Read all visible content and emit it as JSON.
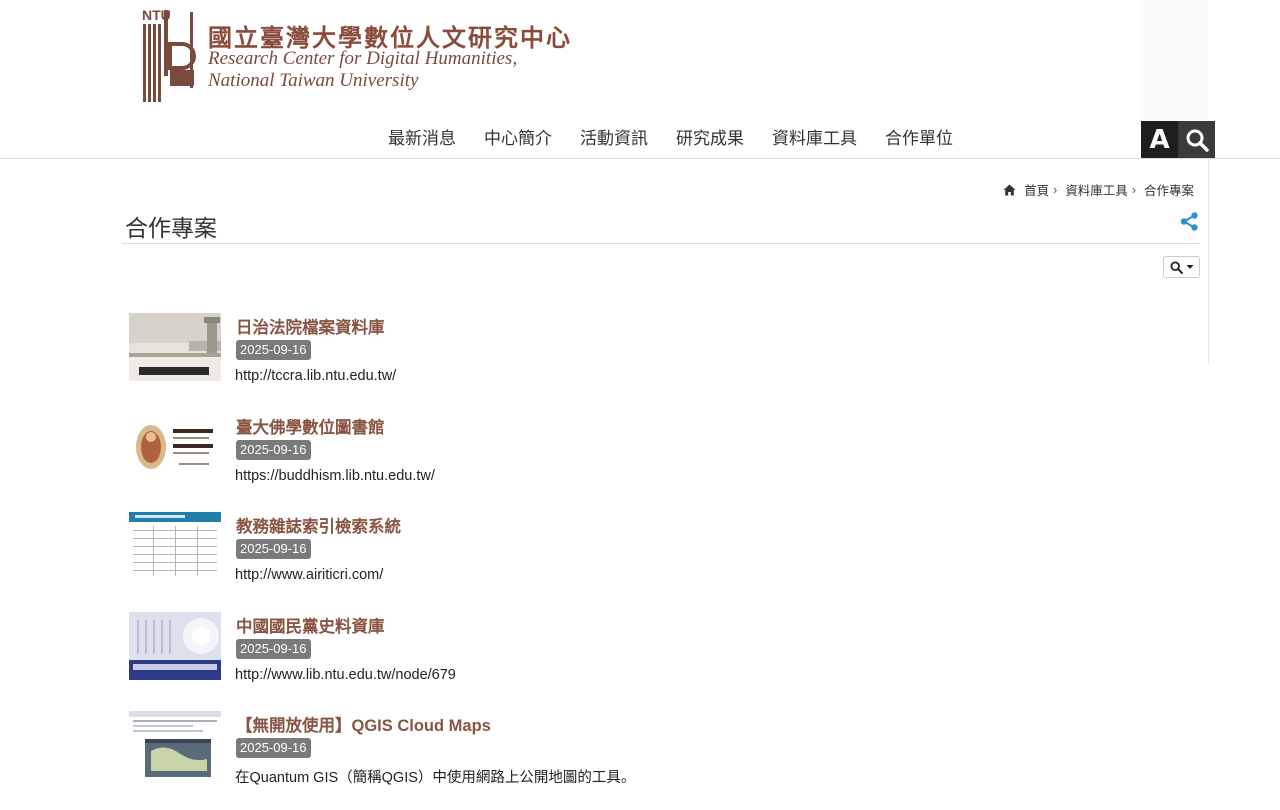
{
  "header": {
    "logo_ntu": "NTU",
    "logo_title": "國立臺灣大學數位人文研究中心",
    "logo_en_line1": "Research Center for Digital Humanities,",
    "logo_en_line2": "National Taiwan University"
  },
  "tools": {
    "font_label": "A"
  },
  "nav": {
    "items": [
      "最新消息",
      "中心簡介",
      "活動資訊",
      "研究成果",
      "資料庫工具",
      "合作單位"
    ]
  },
  "breadcrumb": {
    "items": [
      "首頁",
      "資料庫工具",
      "合作專案"
    ],
    "separator": "›"
  },
  "page": {
    "title": "合作專案"
  },
  "list": {
    "items": [
      {
        "title": "日治法院檔案資料庫",
        "date": "2025-09-16",
        "text": "http://tccra.lib.ntu.edu.tw/"
      },
      {
        "title": "臺大佛學數位圖書館",
        "date": "2025-09-16",
        "text": "https://buddhism.lib.ntu.edu.tw/"
      },
      {
        "title": "教務雜誌索引檢索系統",
        "date": "2025-09-16",
        "text": "http://www.airiticri.com/"
      },
      {
        "title": "中國國民黨史料資庫",
        "date": "2025-09-16",
        "text": "http://www.lib.ntu.edu.tw/node/679"
      },
      {
        "title": "【無開放使用】QGIS Cloud Maps",
        "date": "2025-09-16",
        "text": "在Quantum GIS（簡稱QGIS）中使用網路上公開地圖的工具。"
      }
    ]
  },
  "colors": {
    "brand": "#8a4a3c",
    "item_title": "#8a5443",
    "badge": "#7a7a7a",
    "share": "#2f8fd0"
  }
}
